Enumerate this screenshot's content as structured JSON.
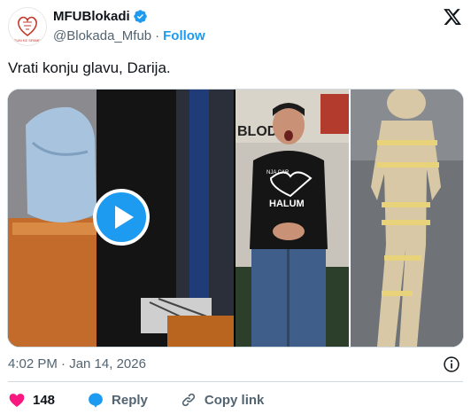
{
  "author": {
    "display_name": "MFUBlokadi",
    "handle": "@Blokada_Mfub",
    "separator": "·",
    "follow_label": "Follow",
    "avatar_caption": "FRUM KE SPAMEN",
    "verified": true
  },
  "tweet": {
    "text": "Vrati konju glavu, Darija."
  },
  "media": {
    "right_image_sign": "BLODE",
    "shirt_text": "NJA CAR",
    "shirt_word": "HALUM"
  },
  "meta": {
    "timestamp": "4:02 PM · Jan 14, 2026"
  },
  "actions": {
    "likes_count": "148",
    "reply_label": "Reply",
    "copy_link_label": "Copy link"
  },
  "colors": {
    "accent": "#1d9bf0",
    "like": "#f91880",
    "muted": "#536471",
    "text": "#0f1419"
  },
  "icons": [
    "verified-badge-icon",
    "x-logo-icon",
    "play-icon",
    "info-icon",
    "heart-icon",
    "reply-icon",
    "link-icon"
  ]
}
